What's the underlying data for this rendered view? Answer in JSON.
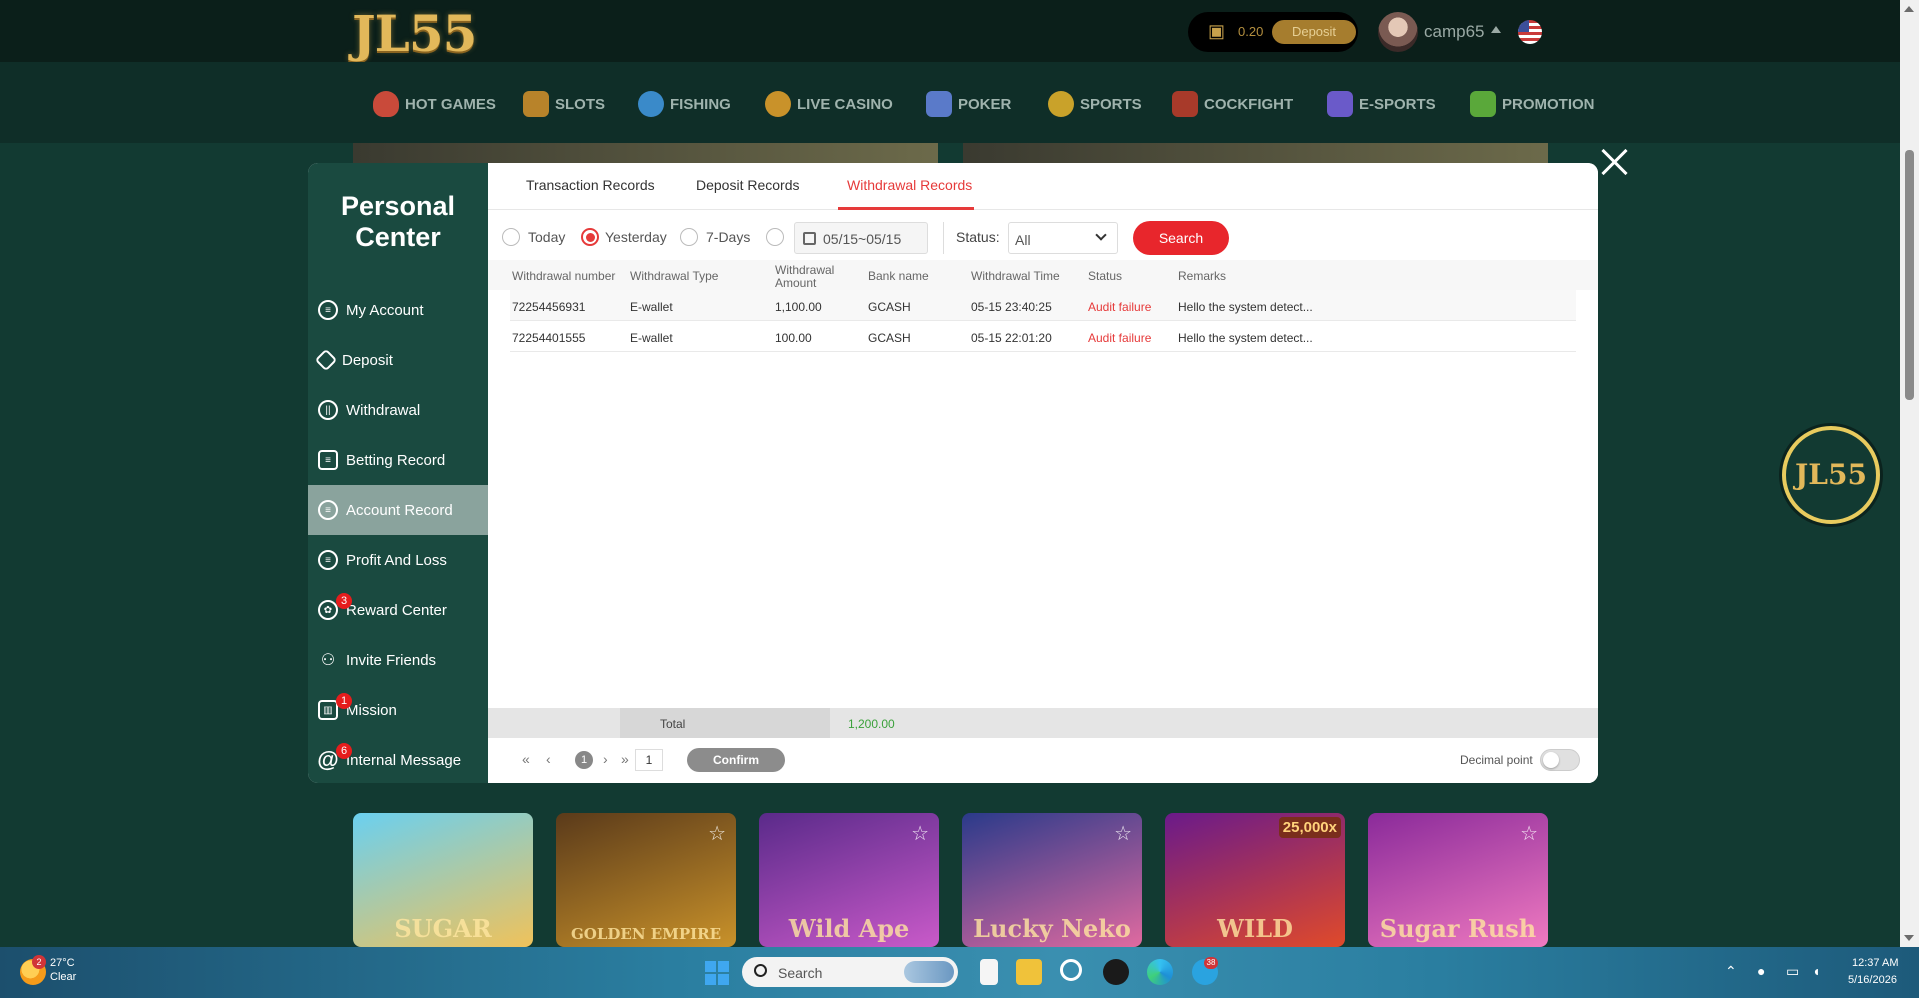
{
  "site": {
    "logo": "JL55",
    "balance": "0.20",
    "deposit_button": "Deposit",
    "username": "camp65"
  },
  "nav": [
    {
      "label": "HOT GAMES",
      "color": "#c94a3a"
    },
    {
      "label": "SLOTS",
      "color": "#b8832a"
    },
    {
      "label": "FISHING",
      "color": "#3a8ac9"
    },
    {
      "label": "LIVE CASINO",
      "color": "#c9922a"
    },
    {
      "label": "POKER",
      "color": "#5a7ac9"
    },
    {
      "label": "SPORTS",
      "color": "#c9a22a"
    },
    {
      "label": "COCKFIGHT",
      "color": "#a83a2a"
    },
    {
      "label": "E-SPORTS",
      "color": "#6a5ac9"
    },
    {
      "label": "PROMOTION",
      "color": "#5aa83a"
    }
  ],
  "games": [
    {
      "name": "SUGAR",
      "colors": [
        "#6ad0f0",
        "#f0c25a"
      ]
    },
    {
      "name": "GOLDEN EMPIRE",
      "colors": [
        "#5a3a1a",
        "#c9922a"
      ]
    },
    {
      "name": "Wild Ape",
      "colors": [
        "#5a2a8a",
        "#c95ac9"
      ]
    },
    {
      "name": "Lucky Neko",
      "colors": [
        "#2a3a8a",
        "#e06aa0"
      ]
    },
    {
      "name": "WILD",
      "colors": [
        "#6a1a8a",
        "#e04a2a"
      ],
      "badge": "25,000x"
    },
    {
      "name": "Sugar Rush",
      "colors": [
        "#8a2a9a",
        "#f07ac0"
      ]
    }
  ],
  "float_logo": "JL55",
  "personal_center": {
    "title": "Personal Center",
    "items": [
      {
        "label": "My Account",
        "icon": "account-icon"
      },
      {
        "label": "Deposit",
        "icon": "deposit-icon"
      },
      {
        "label": "Withdrawal",
        "icon": "withdrawal-icon"
      },
      {
        "label": "Betting Record",
        "icon": "betting-record-icon"
      },
      {
        "label": "Account Record",
        "icon": "account-record-icon",
        "active": true
      },
      {
        "label": "Profit And Loss",
        "icon": "profit-loss-icon"
      },
      {
        "label": "Reward Center",
        "icon": "reward-icon",
        "badge": "3"
      },
      {
        "label": "Invite Friends",
        "icon": "invite-icon"
      },
      {
        "label": "Mission",
        "icon": "gift-icon",
        "badge": "1"
      },
      {
        "label": "Internal Message",
        "icon": "at-icon",
        "badge": "6"
      }
    ]
  },
  "tabs": [
    {
      "label": "Transaction Records"
    },
    {
      "label": "Deposit Records"
    },
    {
      "label": "Withdrawal Records",
      "active": true
    }
  ],
  "filters": {
    "options": [
      "Today",
      "Yesterday",
      "7-Days"
    ],
    "selected": "Yesterday",
    "date_range": "05/15~05/15",
    "status_label": "Status:",
    "status_value": "All",
    "search_button": "Search"
  },
  "table": {
    "headers": [
      "Withdrawal number",
      "Withdrawal Type",
      "Withdrawal Amount",
      "Bank name",
      "Withdrawal Time",
      "Status",
      "Remarks"
    ],
    "rows": [
      [
        "72254456931",
        "E-wallet",
        "1,100.00",
        "GCASH",
        "05-15 23:40:25",
        "Audit failure",
        "Hello the system detect..."
      ],
      [
        "72254401555",
        "E-wallet",
        "100.00",
        "GCASH",
        "05-15 22:01:20",
        "Audit failure",
        "Hello the system detect..."
      ]
    ],
    "total_label": "Total",
    "total_value": "1,200.00"
  },
  "pager": {
    "current_page": "1",
    "page_input": "1",
    "confirm_button": "Confirm",
    "decimal_label": "Decimal point",
    "decimal_on": false
  },
  "taskbar": {
    "weather_temp": "27°C",
    "weather_cond": "Clear",
    "weather_badge": "2",
    "search_placeholder": "Search",
    "app_badge": "38",
    "time": "12:37 AM",
    "date": "5/16/2026"
  }
}
